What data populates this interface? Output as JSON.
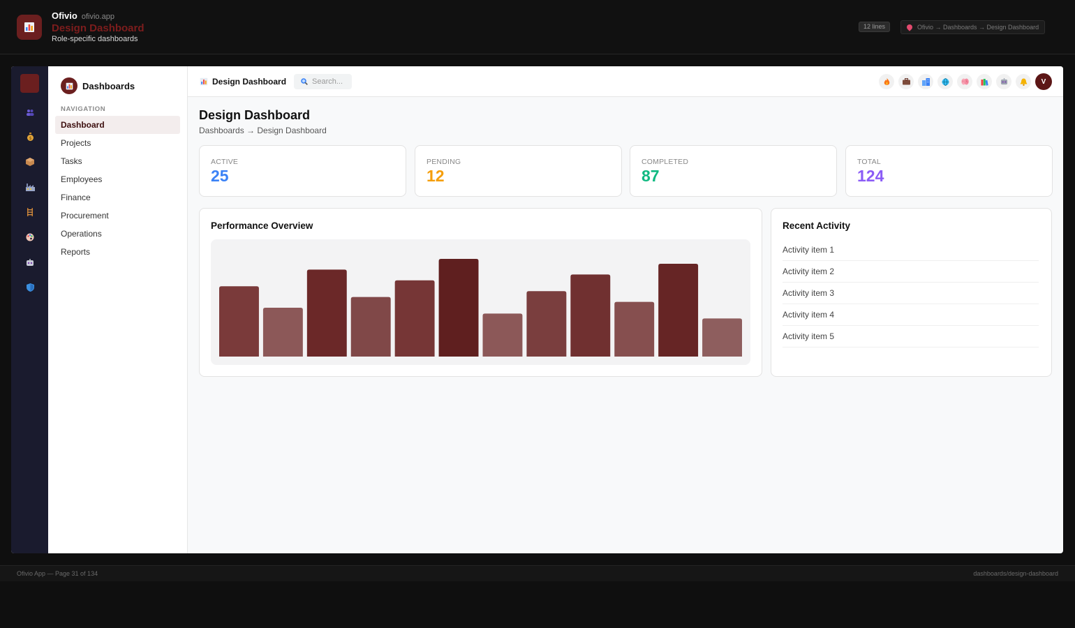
{
  "topbar": {
    "app_name": "Ofivio",
    "app_domain": "ofivio.app",
    "page_title": "Design Dashboard",
    "page_subtitle": "Role-specific dashboards",
    "lines_badge": "12 lines",
    "breadcrumb": "Ofivio → Dashboards → Design Dashboard"
  },
  "rail": {
    "icons": [
      "users-icon",
      "money-bag-icon",
      "package-icon",
      "factory-icon",
      "ladder-icon",
      "palette-icon",
      "robot-icon",
      "shield-icon"
    ]
  },
  "sidebar": {
    "title": "Dashboards",
    "nav_label": "NAVIGATION",
    "items": [
      {
        "label": "Dashboard",
        "active": true
      },
      {
        "label": "Projects",
        "active": false
      },
      {
        "label": "Tasks",
        "active": false
      },
      {
        "label": "Employees",
        "active": false
      },
      {
        "label": "Finance",
        "active": false
      },
      {
        "label": "Procurement",
        "active": false
      },
      {
        "label": "Operations",
        "active": false
      },
      {
        "label": "Reports",
        "active": false
      }
    ]
  },
  "toolbar": {
    "title": "Design Dashboard",
    "search_placeholder": "Search...",
    "icons": [
      "fire-icon",
      "briefcase-icon",
      "buildings-icon",
      "globe-icon",
      "brain-icon",
      "books-icon",
      "robot-icon",
      "bell-icon"
    ],
    "avatar_initial": "V"
  },
  "content": {
    "title": "Design Dashboard",
    "breadcrumb": "Dashboards → Design Dashboard"
  },
  "stats": [
    {
      "label": "ACTIVE",
      "value": "25",
      "color": "#3b82f6"
    },
    {
      "label": "PENDING",
      "value": "12",
      "color": "#f59e0b"
    },
    {
      "label": "COMPLETED",
      "value": "87",
      "color": "#10b981"
    },
    {
      "label": "TOTAL",
      "value": "124",
      "color": "#8b5cf6"
    }
  ],
  "performance": {
    "title": "Performance Overview"
  },
  "chart_data": {
    "type": "bar",
    "title": "Performance Overview",
    "categories": [
      "",
      "",
      "",
      "",
      "",
      "",
      "",
      "",
      "",
      "",
      "",
      ""
    ],
    "values": [
      72,
      50,
      89,
      61,
      78,
      100,
      44,
      67,
      84,
      56,
      95,
      39
    ],
    "colors": [
      "#7a3a3a",
      "#8c5858",
      "#6b2828",
      "#804848",
      "#763636",
      "#5f1f1f",
      "#8c5858",
      "#7a3e3e",
      "#703030",
      "#864f4f",
      "#662525",
      "#8e5e5e"
    ],
    "ylim": [
      0,
      100
    ],
    "grid": false,
    "legend": "none"
  },
  "activity": {
    "title": "Recent Activity",
    "items": [
      "Activity item 1",
      "Activity item 2",
      "Activity item 3",
      "Activity item 4",
      "Activity item 5"
    ]
  },
  "footer": {
    "left": "Ofivio App — Page 31 of 134",
    "right": "dashboards/design-dashboard"
  }
}
